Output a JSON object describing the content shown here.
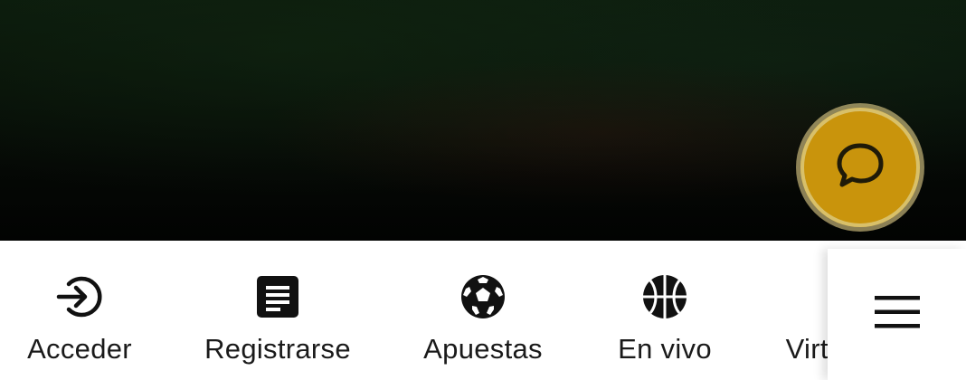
{
  "hero": {
    "background_color": "#050805"
  },
  "chat_button": {
    "icon": "chat-bubble-icon",
    "color": "#c9940c"
  },
  "bottom_nav": {
    "items": [
      {
        "label": "Acceder",
        "icon": "login-icon"
      },
      {
        "label": "Registrarse",
        "icon": "register-document-icon"
      },
      {
        "label": "Apuestas",
        "icon": "soccer-ball-icon"
      },
      {
        "label": "En vivo",
        "icon": "basketball-icon"
      },
      {
        "label": "Virtuales",
        "icon": "bookmark-icon"
      }
    ]
  },
  "menu_button": {
    "icon": "hamburger-menu-icon"
  }
}
